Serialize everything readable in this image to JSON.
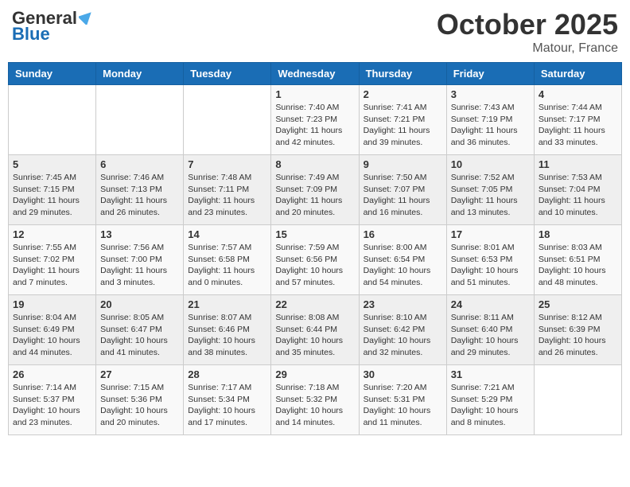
{
  "header": {
    "logo_general": "General",
    "logo_blue": "Blue",
    "month_title": "October 2025",
    "location": "Matour, France"
  },
  "weekdays": [
    "Sunday",
    "Monday",
    "Tuesday",
    "Wednesday",
    "Thursday",
    "Friday",
    "Saturday"
  ],
  "weeks": [
    [
      {
        "day": "",
        "info": ""
      },
      {
        "day": "",
        "info": ""
      },
      {
        "day": "",
        "info": ""
      },
      {
        "day": "1",
        "info": "Sunrise: 7:40 AM\nSunset: 7:23 PM\nDaylight: 11 hours\nand 42 minutes."
      },
      {
        "day": "2",
        "info": "Sunrise: 7:41 AM\nSunset: 7:21 PM\nDaylight: 11 hours\nand 39 minutes."
      },
      {
        "day": "3",
        "info": "Sunrise: 7:43 AM\nSunset: 7:19 PM\nDaylight: 11 hours\nand 36 minutes."
      },
      {
        "day": "4",
        "info": "Sunrise: 7:44 AM\nSunset: 7:17 PM\nDaylight: 11 hours\nand 33 minutes."
      }
    ],
    [
      {
        "day": "5",
        "info": "Sunrise: 7:45 AM\nSunset: 7:15 PM\nDaylight: 11 hours\nand 29 minutes."
      },
      {
        "day": "6",
        "info": "Sunrise: 7:46 AM\nSunset: 7:13 PM\nDaylight: 11 hours\nand 26 minutes."
      },
      {
        "day": "7",
        "info": "Sunrise: 7:48 AM\nSunset: 7:11 PM\nDaylight: 11 hours\nand 23 minutes."
      },
      {
        "day": "8",
        "info": "Sunrise: 7:49 AM\nSunset: 7:09 PM\nDaylight: 11 hours\nand 20 minutes."
      },
      {
        "day": "9",
        "info": "Sunrise: 7:50 AM\nSunset: 7:07 PM\nDaylight: 11 hours\nand 16 minutes."
      },
      {
        "day": "10",
        "info": "Sunrise: 7:52 AM\nSunset: 7:05 PM\nDaylight: 11 hours\nand 13 minutes."
      },
      {
        "day": "11",
        "info": "Sunrise: 7:53 AM\nSunset: 7:04 PM\nDaylight: 11 hours\nand 10 minutes."
      }
    ],
    [
      {
        "day": "12",
        "info": "Sunrise: 7:55 AM\nSunset: 7:02 PM\nDaylight: 11 hours\nand 7 minutes."
      },
      {
        "day": "13",
        "info": "Sunrise: 7:56 AM\nSunset: 7:00 PM\nDaylight: 11 hours\nand 3 minutes."
      },
      {
        "day": "14",
        "info": "Sunrise: 7:57 AM\nSunset: 6:58 PM\nDaylight: 11 hours\nand 0 minutes."
      },
      {
        "day": "15",
        "info": "Sunrise: 7:59 AM\nSunset: 6:56 PM\nDaylight: 10 hours\nand 57 minutes."
      },
      {
        "day": "16",
        "info": "Sunrise: 8:00 AM\nSunset: 6:54 PM\nDaylight: 10 hours\nand 54 minutes."
      },
      {
        "day": "17",
        "info": "Sunrise: 8:01 AM\nSunset: 6:53 PM\nDaylight: 10 hours\nand 51 minutes."
      },
      {
        "day": "18",
        "info": "Sunrise: 8:03 AM\nSunset: 6:51 PM\nDaylight: 10 hours\nand 48 minutes."
      }
    ],
    [
      {
        "day": "19",
        "info": "Sunrise: 8:04 AM\nSunset: 6:49 PM\nDaylight: 10 hours\nand 44 minutes."
      },
      {
        "day": "20",
        "info": "Sunrise: 8:05 AM\nSunset: 6:47 PM\nDaylight: 10 hours\nand 41 minutes."
      },
      {
        "day": "21",
        "info": "Sunrise: 8:07 AM\nSunset: 6:46 PM\nDaylight: 10 hours\nand 38 minutes."
      },
      {
        "day": "22",
        "info": "Sunrise: 8:08 AM\nSunset: 6:44 PM\nDaylight: 10 hours\nand 35 minutes."
      },
      {
        "day": "23",
        "info": "Sunrise: 8:10 AM\nSunset: 6:42 PM\nDaylight: 10 hours\nand 32 minutes."
      },
      {
        "day": "24",
        "info": "Sunrise: 8:11 AM\nSunset: 6:40 PM\nDaylight: 10 hours\nand 29 minutes."
      },
      {
        "day": "25",
        "info": "Sunrise: 8:12 AM\nSunset: 6:39 PM\nDaylight: 10 hours\nand 26 minutes."
      }
    ],
    [
      {
        "day": "26",
        "info": "Sunrise: 7:14 AM\nSunset: 5:37 PM\nDaylight: 10 hours\nand 23 minutes."
      },
      {
        "day": "27",
        "info": "Sunrise: 7:15 AM\nSunset: 5:36 PM\nDaylight: 10 hours\nand 20 minutes."
      },
      {
        "day": "28",
        "info": "Sunrise: 7:17 AM\nSunset: 5:34 PM\nDaylight: 10 hours\nand 17 minutes."
      },
      {
        "day": "29",
        "info": "Sunrise: 7:18 AM\nSunset: 5:32 PM\nDaylight: 10 hours\nand 14 minutes."
      },
      {
        "day": "30",
        "info": "Sunrise: 7:20 AM\nSunset: 5:31 PM\nDaylight: 10 hours\nand 11 minutes."
      },
      {
        "day": "31",
        "info": "Sunrise: 7:21 AM\nSunset: 5:29 PM\nDaylight: 10 hours\nand 8 minutes."
      },
      {
        "day": "",
        "info": ""
      }
    ]
  ]
}
